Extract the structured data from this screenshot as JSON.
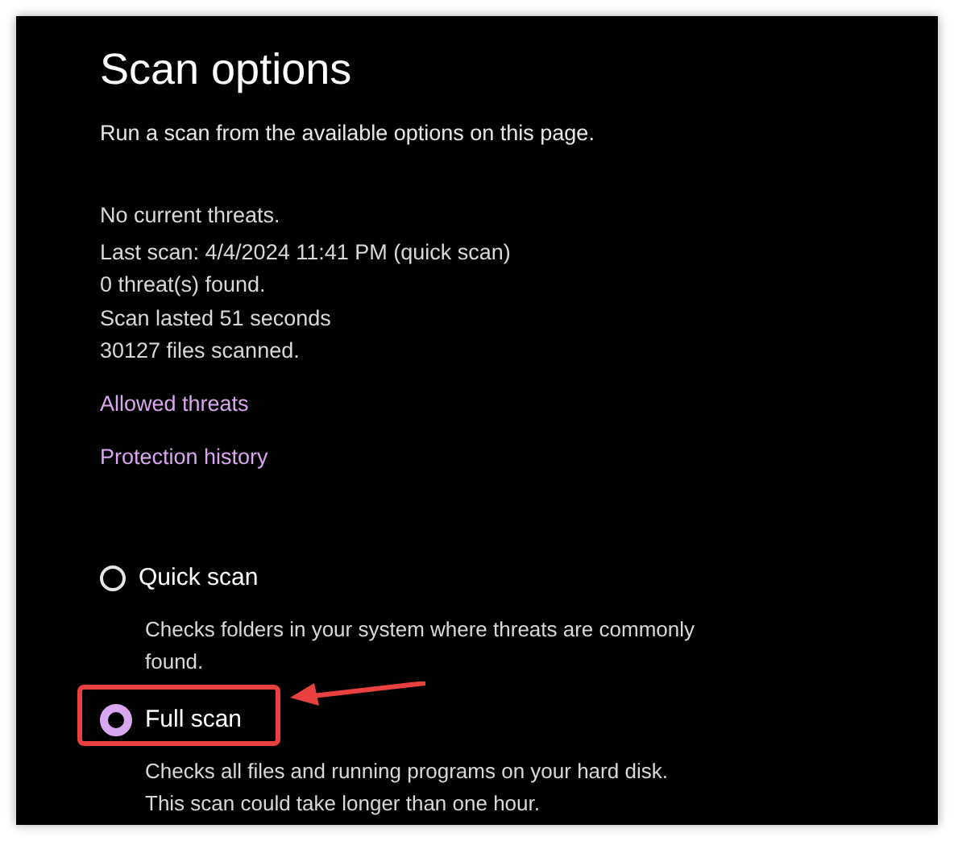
{
  "title": "Scan options",
  "subtitle": "Run a scan from the available options on this page.",
  "status_lines": [
    "No current threats.",
    "Last scan: 4/4/2024 11:41 PM (quick scan)",
    "0 threat(s) found.",
    "Scan lasted 51 seconds",
    "30127 files scanned."
  ],
  "links": [
    "Allowed threats",
    "Protection history"
  ],
  "scan_options": [
    {
      "label": "Quick scan",
      "description": "Checks folders in your system where threats are commonly found.",
      "selected": false,
      "highlighted": false
    },
    {
      "label": "Full scan",
      "description": "Checks all files and running programs on your hard disk. This scan could take longer than one hour.",
      "selected": true,
      "highlighted": true
    }
  ]
}
